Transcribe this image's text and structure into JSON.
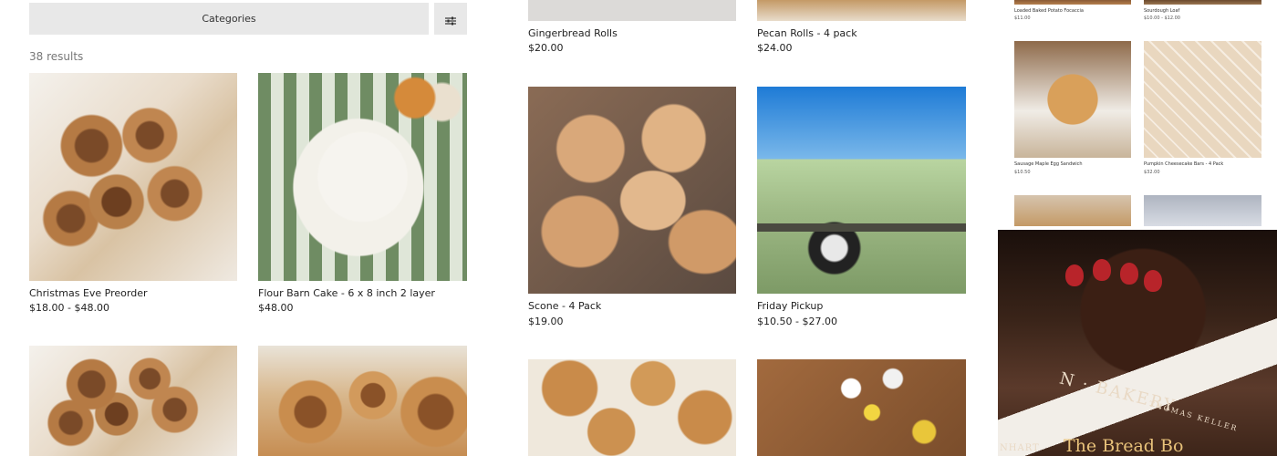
{
  "toolbar": {
    "categories_label": "Categories",
    "filter_icon": "sliders-icon",
    "results": "38 results"
  },
  "column1": [
    {
      "name": "Christmas Eve Preorder",
      "price": "$18.00 - $48.00"
    },
    {
      "name": "Flour Barn Cake - 6 x 8 inch 2 layer",
      "price": "$48.00"
    }
  ],
  "column2": [
    {
      "name": "Gingerbread Rolls",
      "price": "$20.00"
    },
    {
      "name": "Pecan Rolls - 4 pack",
      "price": "$24.00"
    },
    {
      "name": "Scone - 4 Pack",
      "price": "$19.00"
    },
    {
      "name": "Friday Pickup",
      "price": "$10.50 - $27.00"
    }
  ],
  "thumbs": [
    {
      "name": "Loaded Baked Potato Focaccia",
      "price": "$11.00"
    },
    {
      "name": "Sourdough Loaf",
      "price": "$10.00 - $12.00"
    },
    {
      "name": "Sausage Maple Egg Sandwich",
      "price": "$10.50"
    },
    {
      "name": "Pumpkin Cheesecake Bars - 4 Pack",
      "price": "$32.00"
    }
  ],
  "overlay": {
    "text1": "N · BAKERY",
    "text2": "THOMAS KELLER",
    "text3": "The Bread Bo",
    "text4": "NHART"
  }
}
